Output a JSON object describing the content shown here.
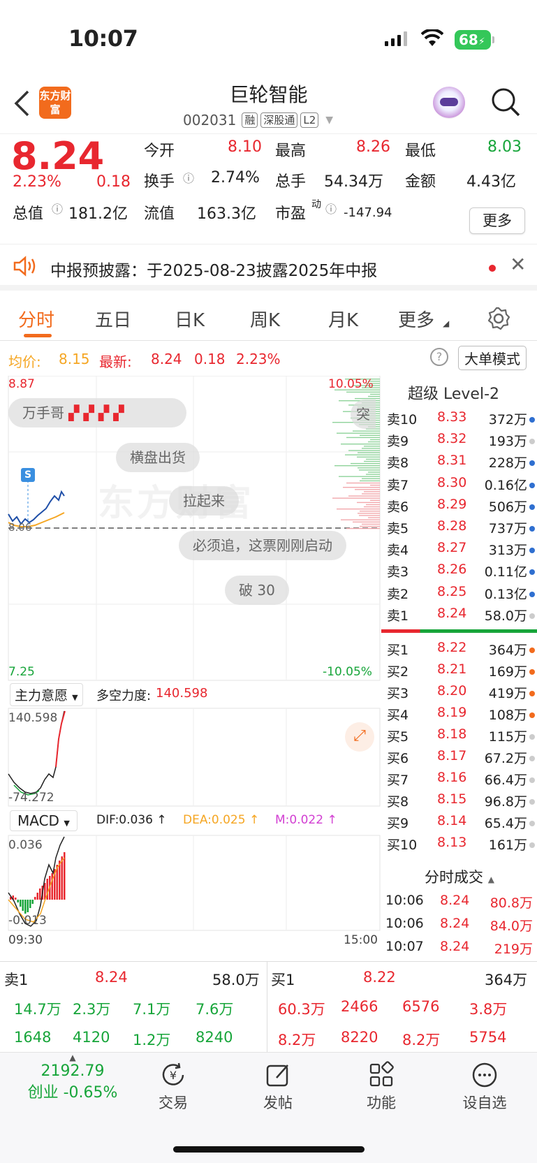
{
  "status": {
    "time": "10:07",
    "battery": "68"
  },
  "header": {
    "logo": "东方财富",
    "name": "巨轮智能",
    "code": "002031",
    "tags": [
      "融",
      "深股通",
      "L2"
    ]
  },
  "quote": {
    "price": "8.24",
    "pct": "2.23%",
    "chg": "0.18",
    "open_label": "今开",
    "open": "8.10",
    "high_label": "最高",
    "high": "8.26",
    "low_label": "最低",
    "low": "8.03",
    "turnover_label": "换手",
    "turnover": "2.74%",
    "volume_label": "总手",
    "volume": "54.34万",
    "amount_label": "金额",
    "amount": "4.43亿",
    "mcap_label": "总值",
    "mcap": "181.2亿",
    "float_label": "流值",
    "float": "163.3亿",
    "pe_label": "市盈",
    "pe_sup": "动",
    "pe": "-147.94",
    "more": "更多"
  },
  "notice": {
    "text": "中报预披露：于2025-08-23披露2025年中报"
  },
  "tabs": [
    "分时",
    "五日",
    "日K",
    "周K",
    "月K",
    "更多"
  ],
  "avg": {
    "avg_label": "均价:",
    "avg": "8.15",
    "latest_label": "最新:",
    "latest": "8.24",
    "chg": "0.18",
    "pct": "2.23%",
    "mode": "大单模式"
  },
  "chart": {
    "top_price": "8.87",
    "top_pct": "10.05%",
    "bottom_price": "7.25",
    "bottom_pct": "-10.05%",
    "mid_label": "8.06",
    "watermark": "东方财富",
    "s_marker": "S",
    "bubbles": [
      "万手哥",
      "横盘出货",
      "拉起来",
      "必须追，这票刚刚启动",
      "破 30",
      "突"
    ],
    "ind1_name": "主力意愿",
    "ind1_label": "多空力度:",
    "ind1_value": "140.598",
    "ind1_max": "140.598",
    "ind1_min": "-74.272",
    "macd_name": "MACD",
    "dif": "DIF:0.036 ↑",
    "dea": "DEA:0.025 ↑",
    "m": "M:0.022 ↑",
    "macd_max": "0.036",
    "macd_min": "-0.013",
    "t_start": "09:30",
    "t_end": "15:00"
  },
  "orderbook": {
    "title": "超级 Level-2",
    "asks": [
      [
        "卖10",
        "8.33",
        "372万"
      ],
      [
        "卖9",
        "8.32",
        "193万"
      ],
      [
        "卖8",
        "8.31",
        "228万"
      ],
      [
        "卖7",
        "8.30",
        "0.16亿"
      ],
      [
        "卖6",
        "8.29",
        "506万"
      ],
      [
        "卖5",
        "8.28",
        "737万"
      ],
      [
        "卖4",
        "8.27",
        "313万"
      ],
      [
        "卖3",
        "8.26",
        "0.11亿"
      ],
      [
        "卖2",
        "8.25",
        "0.13亿"
      ],
      [
        "卖1",
        "8.24",
        "58.0万"
      ]
    ],
    "bids": [
      [
        "买1",
        "8.22",
        "364万"
      ],
      [
        "买2",
        "8.21",
        "169万"
      ],
      [
        "买3",
        "8.20",
        "419万"
      ],
      [
        "买4",
        "8.19",
        "108万"
      ],
      [
        "买5",
        "8.18",
        "115万"
      ],
      [
        "买6",
        "8.17",
        "67.2万"
      ],
      [
        "买7",
        "8.16",
        "66.4万"
      ],
      [
        "买8",
        "8.15",
        "96.8万"
      ],
      [
        "买9",
        "8.14",
        "65.4万"
      ],
      [
        "买10",
        "8.13",
        "161万"
      ]
    ]
  },
  "trades": {
    "title": "分时成交",
    "rows": [
      [
        "10:06",
        "8.24",
        "80.8万"
      ],
      [
        "10:06",
        "8.24",
        "84.0万"
      ],
      [
        "10:07",
        "8.24",
        "219万"
      ]
    ]
  },
  "bottom": {
    "sell_label": "卖1",
    "sell_price": "8.24",
    "sell_vol": "58.0万",
    "buy_label": "买1",
    "buy_price": "8.22",
    "buy_vol": "364万",
    "sell_row1": [
      "14.7万",
      "2.3万",
      "7.1万",
      "7.6万"
    ],
    "sell_row2": [
      "1648",
      "4120",
      "1.2万",
      "8240"
    ],
    "buy_row1": [
      "60.3万",
      "2466",
      "6576",
      "3.8万"
    ],
    "buy_row2": [
      "8.2万",
      "8220",
      "8.2万",
      "5754"
    ]
  },
  "nav": {
    "index_value": "2192.79",
    "index_label": "创业 -0.65%",
    "items": [
      "交易",
      "发帖",
      "功能",
      "设自选"
    ]
  }
}
